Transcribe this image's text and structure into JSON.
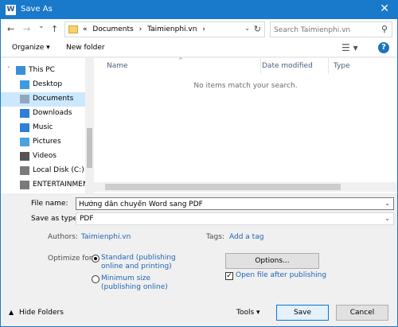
{
  "window": {
    "title": "Save As",
    "app_icon_letter": "W",
    "close_glyph": "✕"
  },
  "nav": {
    "back": "←",
    "forward": "→",
    "recent": "⌄",
    "up": "↑",
    "breadcrumb": [
      "«",
      "Documents",
      "›",
      "Taimienphi.vn",
      "›"
    ],
    "address_dropdown": "⌄",
    "refresh": "↻",
    "search_placeholder": "Search Taimienphi.vn",
    "search_icon": "search-icon"
  },
  "toolbar": {
    "organize_label": "Organize ▾",
    "new_folder_label": "New folder",
    "view_glyph": "☰ ▾",
    "help_glyph": "?"
  },
  "sidebar": {
    "items": [
      {
        "label": "This PC",
        "icon": "computer-icon",
        "color": "#3a8fd8"
      },
      {
        "label": "Desktop",
        "icon": "desktop-icon",
        "color": "#3f9be0"
      },
      {
        "label": "Documents",
        "icon": "documents-icon",
        "color": "#8fa7c0",
        "selected": true
      },
      {
        "label": "Downloads",
        "icon": "downloads-icon",
        "color": "#2e7fd6"
      },
      {
        "label": "Music",
        "icon": "music-icon",
        "color": "#2e7fd6"
      },
      {
        "label": "Pictures",
        "icon": "pictures-icon",
        "color": "#4aa3df"
      },
      {
        "label": "Videos",
        "icon": "videos-icon",
        "color": "#555555"
      },
      {
        "label": "Local Disk (C:)",
        "icon": "drive-icon",
        "color": "#7a7a7a"
      },
      {
        "label": "ENTERTAINMEN",
        "icon": "drive-icon",
        "color": "#7a7a7a"
      }
    ]
  },
  "columns": [
    "Name",
    "Date modified",
    "Type"
  ],
  "empty_message": "No items match your search.",
  "form": {
    "file_name_label": "File name:",
    "file_name_value": "Hướng dẫn chuyển Word sang PDF",
    "save_as_type_label": "Save as type:",
    "save_as_type_value": "PDF",
    "authors_label": "Authors:",
    "authors_value": "Taimienphi.vn",
    "tags_label": "Tags:",
    "tags_value": "Add a tag",
    "optimize_label": "Optimize for:",
    "option_standard_line1": "Standard (publishing",
    "option_standard_line2": "online and printing)",
    "option_minimum_line1": "Minimum size",
    "option_minimum_line2": "(publishing online)",
    "options_button": "Options...",
    "open_after_label": "Open file after publishing"
  },
  "footer": {
    "hide_folders": "Hide Folders",
    "tools_label": "Tools ▾",
    "save_button": "Save",
    "cancel_button": "Cancel"
  }
}
